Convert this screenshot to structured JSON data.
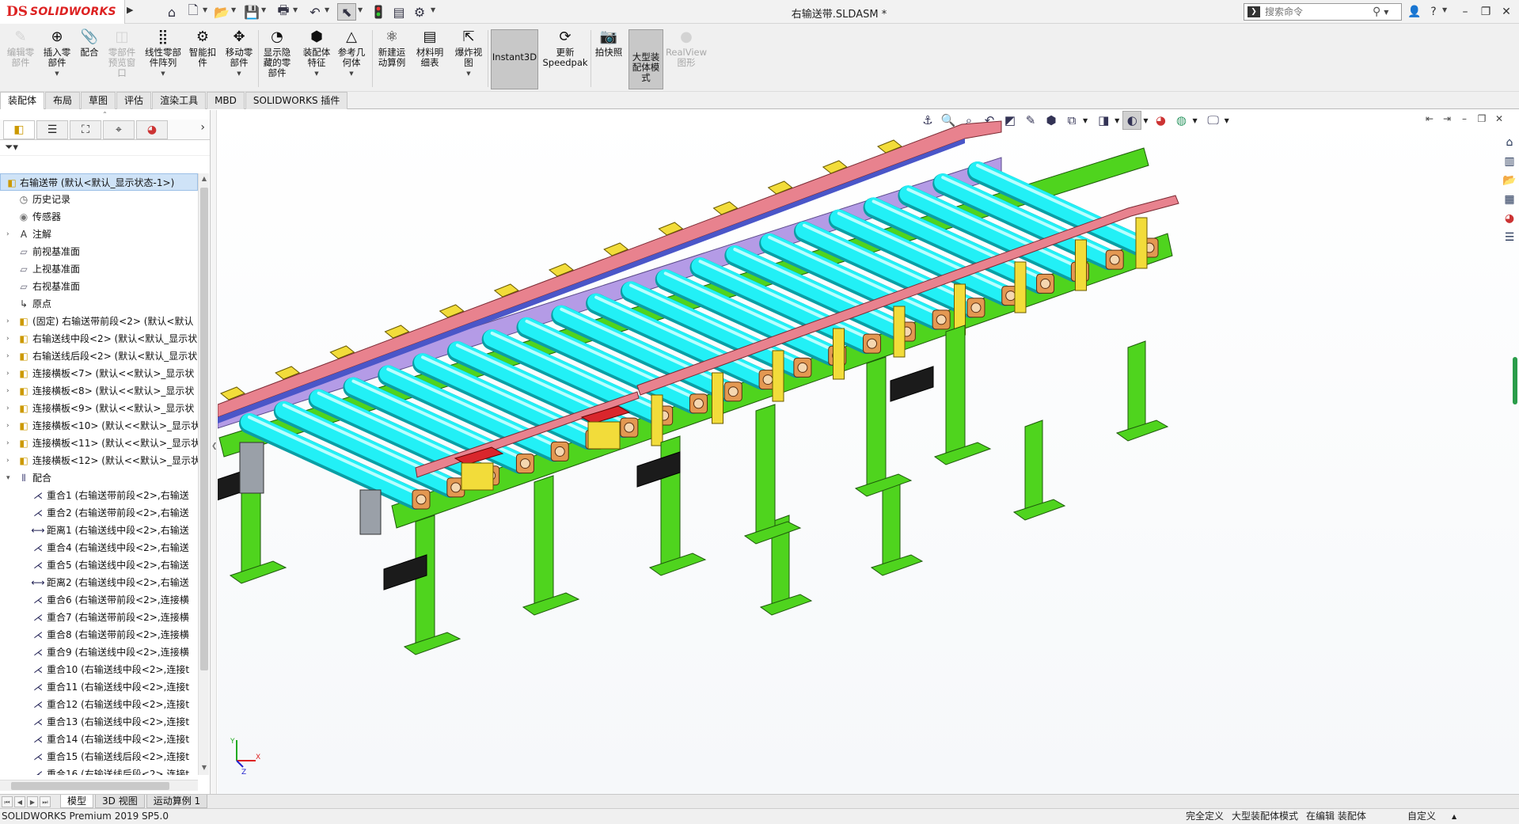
{
  "window": {
    "logo_ds": "DS",
    "logo_text": "SOLIDWORKS",
    "document_title": "右输送带.SLDASM *",
    "search_placeholder": "搜索命令"
  },
  "quick_access": {
    "icons": [
      "home-icon",
      "new-document-icon",
      "open-icon",
      "save-icon",
      "print-icon",
      "undo-icon",
      "select-icon",
      "rebuild-icon",
      "file-properties-icon",
      "options-icon"
    ]
  },
  "command_manager": {
    "buttons": [
      {
        "id": "edit-component",
        "label": "编辑零\n部件",
        "enabled": false
      },
      {
        "id": "insert-component",
        "label": "插入零\n部件",
        "enabled": true,
        "dropdown": true
      },
      {
        "id": "mate",
        "label": "配合",
        "enabled": true
      },
      {
        "id": "component-preview",
        "label": "零部件\n预览窗\n口",
        "enabled": false
      },
      {
        "id": "linear-pattern",
        "label": "线性零部\n件阵列",
        "enabled": true,
        "dropdown": true
      },
      {
        "id": "smart-fasteners",
        "label": "智能扣\n件",
        "enabled": true
      },
      {
        "id": "move-component",
        "label": "移动零\n部件",
        "enabled": true,
        "dropdown": true
      },
      {
        "id": "show-hidden",
        "label": "显示隐\n藏的零\n部件",
        "enabled": true
      },
      {
        "id": "assembly-features",
        "label": "装配体\n特征",
        "enabled": true,
        "dropdown": true
      },
      {
        "id": "reference-geometry",
        "label": "参考几\n何体",
        "enabled": true,
        "dropdown": true
      },
      {
        "id": "new-motion-study",
        "label": "新建运\n动算例",
        "enabled": true
      },
      {
        "id": "bill-of-materials",
        "label": "材料明\n细表",
        "enabled": true
      },
      {
        "id": "exploded-view",
        "label": "爆炸视\n图",
        "enabled": true,
        "dropdown": true
      },
      {
        "id": "instant3d",
        "label": "Instant3D",
        "enabled": true,
        "active": true
      },
      {
        "id": "update-speedpak",
        "label": "更新\nSpeedpak",
        "enabled": true
      },
      {
        "id": "take-snapshot",
        "label": "拍快照",
        "enabled": true
      },
      {
        "id": "large-assembly-mode",
        "label": "大型装\n配体模\n式",
        "enabled": true,
        "active": true
      },
      {
        "id": "realview",
        "label": "RealView\n图形",
        "enabled": false
      }
    ]
  },
  "tabs": [
    "装配体",
    "布局",
    "草图",
    "评估",
    "渲染工具",
    "MBD",
    "SOLIDWORKS 插件"
  ],
  "feature_tree": {
    "root": "右输送带  (默认<默认_显示状态-1>)",
    "items": [
      {
        "label": "历史记录",
        "icon": "history-icon",
        "expand": false
      },
      {
        "label": "传感器",
        "icon": "sensor-icon",
        "expand": false
      },
      {
        "label": "注解",
        "icon": "annotation-icon",
        "expand": true
      },
      {
        "label": "前视基准面",
        "icon": "plane-icon",
        "expand": false
      },
      {
        "label": "上视基准面",
        "icon": "plane-icon",
        "expand": false
      },
      {
        "label": "右视基准面",
        "icon": "plane-icon",
        "expand": false
      },
      {
        "label": "原点",
        "icon": "origin-icon",
        "expand": false
      },
      {
        "label": "(固定) 右输送带前段<2> (默认<默认",
        "icon": "part-icon",
        "expand": true
      },
      {
        "label": "右输送线中段<2> (默认<默认_显示状",
        "icon": "part-icon",
        "expand": true
      },
      {
        "label": "右输送线后段<2> (默认<默认_显示状",
        "icon": "part-icon",
        "expand": true
      },
      {
        "label": "连接横板<7> (默认<<默认>_显示状",
        "icon": "part-icon",
        "expand": true
      },
      {
        "label": "连接横板<8> (默认<<默认>_显示状",
        "icon": "part-icon",
        "expand": true
      },
      {
        "label": "连接横板<9> (默认<<默认>_显示状",
        "icon": "part-icon",
        "expand": true
      },
      {
        "label": "连接横板<10> (默认<<默认>_显示状",
        "icon": "part-icon",
        "expand": true
      },
      {
        "label": "连接横板<11> (默认<<默认>_显示状",
        "icon": "part-icon",
        "expand": true
      },
      {
        "label": "连接横板<12> (默认<<默认>_显示状",
        "icon": "part-icon",
        "expand": true
      },
      {
        "label": "配合",
        "icon": "mates-folder-icon",
        "expand": "open"
      }
    ],
    "mates": [
      {
        "label": "重合1 (右输送带前段<2>,右输送",
        "icon": "coincident-icon"
      },
      {
        "label": "重合2 (右输送带前段<2>,右输送",
        "icon": "coincident-icon"
      },
      {
        "label": "距离1 (右输送线中段<2>,右输送",
        "icon": "distance-icon"
      },
      {
        "label": "重合4 (右输送线中段<2>,右输送",
        "icon": "coincident-icon"
      },
      {
        "label": "重合5 (右输送线中段<2>,右输送",
        "icon": "coincident-icon"
      },
      {
        "label": "距离2 (右输送线中段<2>,右输送",
        "icon": "distance-icon"
      },
      {
        "label": "重合6 (右输送带前段<2>,连接横",
        "icon": "coincident-icon"
      },
      {
        "label": "重合7 (右输送带前段<2>,连接横",
        "icon": "coincident-icon"
      },
      {
        "label": "重合8 (右输送带前段<2>,连接横",
        "icon": "coincident-icon"
      },
      {
        "label": "重合9 (右输送线中段<2>,连接横",
        "icon": "coincident-icon"
      },
      {
        "label": "重合10 (右输送线中段<2>,连接t",
        "icon": "coincident-icon"
      },
      {
        "label": "重合11 (右输送线中段<2>,连接t",
        "icon": "coincident-icon"
      },
      {
        "label": "重合12 (右输送线中段<2>,连接t",
        "icon": "coincident-icon"
      },
      {
        "label": "重合13 (右输送线中段<2>,连接t",
        "icon": "coincident-icon"
      },
      {
        "label": "重合14 (右输送线中段<2>,连接t",
        "icon": "coincident-icon"
      },
      {
        "label": "重合15 (右输送线后段<2>,连接t",
        "icon": "coincident-icon"
      },
      {
        "label": "重合16 (右输送线后段<2>,连接t",
        "icon": "coincident-icon"
      }
    ]
  },
  "model_tabs": [
    "模型",
    "3D 视图",
    "运动算例 1"
  ],
  "status": {
    "product": "SOLIDWORKS Premium 2019 SP5.0",
    "fully_defined": "完全定义",
    "large_assembly": "大型装配体模式",
    "editing": "在编辑 装配体",
    "custom": "自定义"
  },
  "triad": {
    "x": "X",
    "y": "Y",
    "z": "Z"
  },
  "colors": {
    "roller": "#22f0f6",
    "rail": "#e8828e",
    "frame": "#4fd41e",
    "bracket": "#f2dc3a",
    "bearing": "#e39852",
    "plate": "#b49be6",
    "accent": "#d9262c"
  }
}
